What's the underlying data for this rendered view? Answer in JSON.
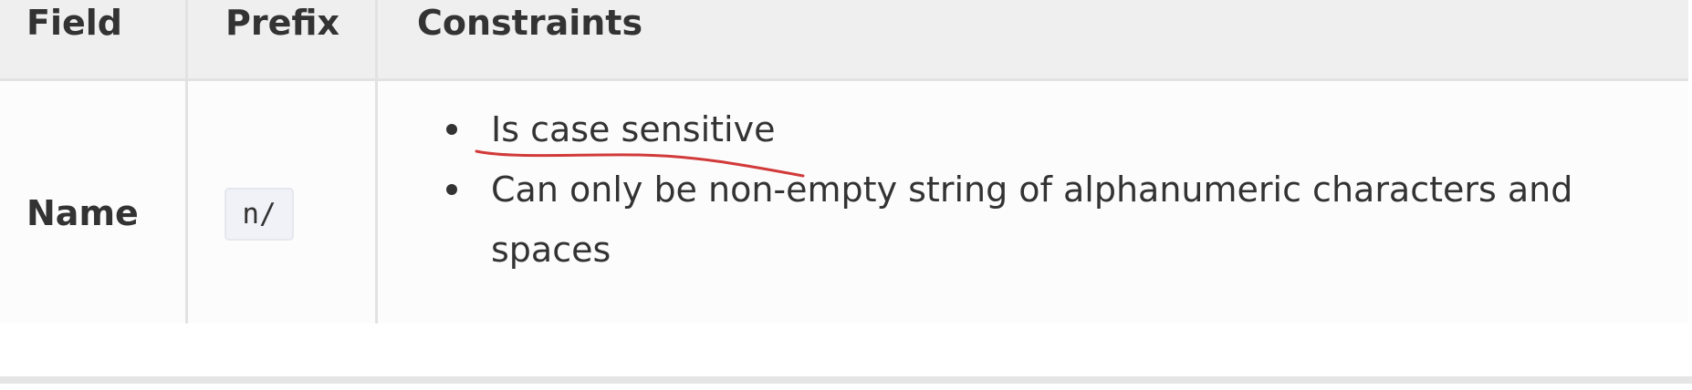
{
  "table": {
    "headers": {
      "field": "Field",
      "prefix": "Prefix",
      "constraints": "Constraints"
    },
    "rows": [
      {
        "field": "Name",
        "prefix": "n/",
        "constraints": [
          "Is case sensitive",
          "Can only be non-empty string of alphanumeric characters and spaces"
        ]
      }
    ]
  },
  "annotation": {
    "color": "#d23a3a",
    "type": "hand-drawn underline"
  },
  "colors": {
    "header_background": "#efefef",
    "row_background": "#fcfcfc",
    "border": "#e2e2e2",
    "text": "#333333",
    "code_background": "#f1f1f8"
  }
}
